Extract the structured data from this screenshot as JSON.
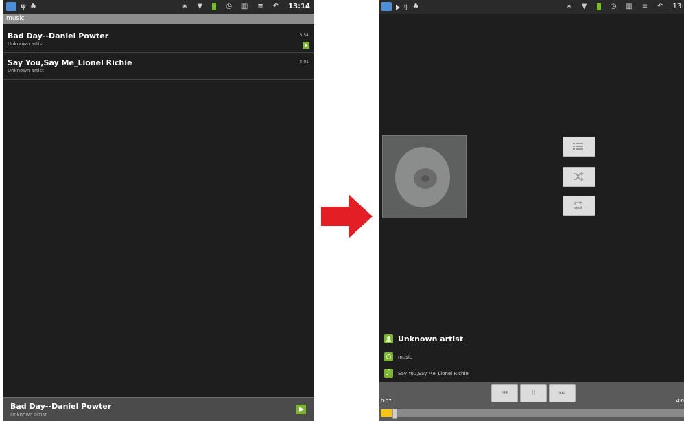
{
  "left_screen": {
    "status_time": "13:14",
    "header": "music",
    "songs": [
      {
        "title": "Bad Day--Daniel Powter",
        "artist": "Unknown artist",
        "duration": "3:54"
      },
      {
        "title": "Say You,Say Me_Lionel Richie",
        "artist": "Unknown artist",
        "duration": "4:01"
      }
    ],
    "now_playing": {
      "title": "Bad Day--Daniel Powter",
      "artist": "Unknown artist"
    }
  },
  "right_screen": {
    "status_time": "13:1",
    "artist": "Unknown artist",
    "album": "music",
    "track": "Say You,Say Me_Lionel Richie",
    "elapsed": "0:07",
    "total": "4:0",
    "progress": 0.04,
    "controls": {
      "prev": "⏮",
      "pause": "II",
      "next": "⏭"
    }
  },
  "icons": [
    "app-icon",
    "usb-icon",
    "android-icon",
    "bluetooth-icon",
    "wifi-icon",
    "battery-icon",
    "alarm-icon",
    "shop-icon",
    "signal-icon",
    "back-icon",
    "play-icon",
    "album-art-icon",
    "playlist-icon",
    "shuffle-icon",
    "repeat-icon",
    "artist-icon",
    "album-icon",
    "track-icon"
  ],
  "colors": {
    "accent_green": "#7cb62c",
    "progress_yellow": "#f5c518",
    "arrow_red": "#e31e24",
    "background": "#1f1e1e"
  }
}
